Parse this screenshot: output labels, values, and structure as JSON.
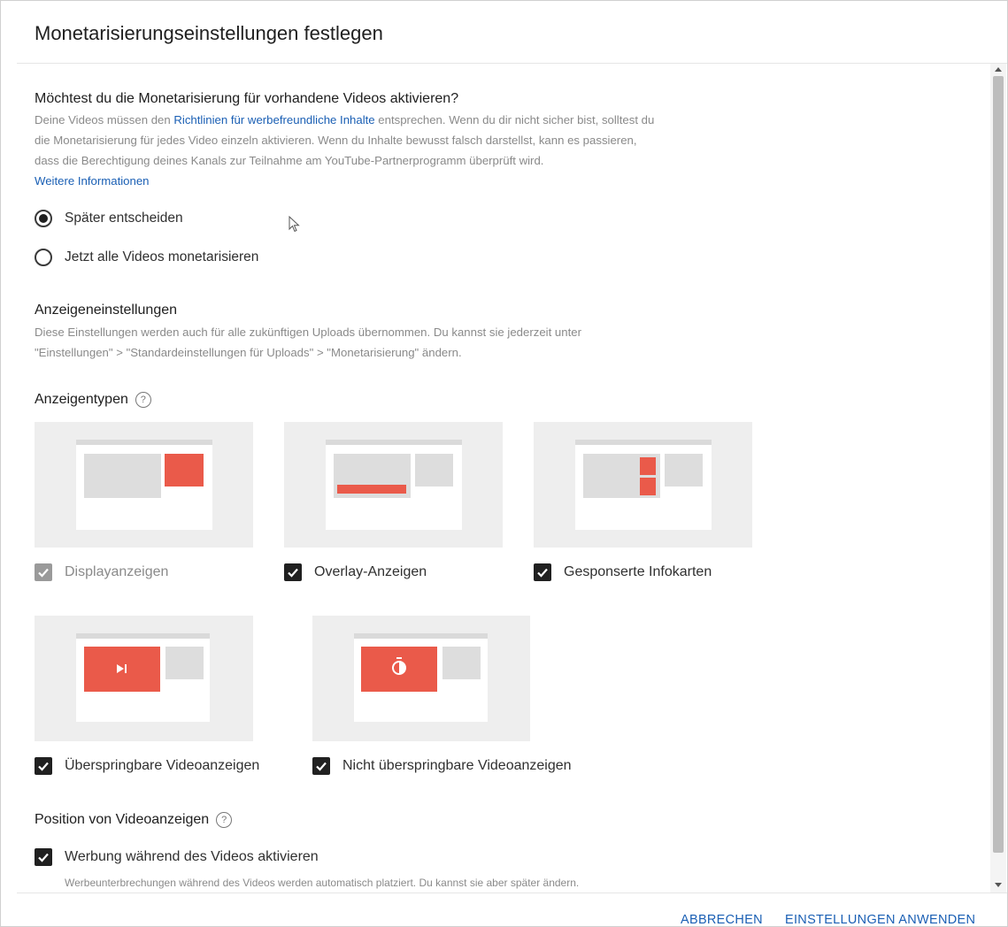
{
  "dialog": {
    "title": "Monetarisierungseinstellungen festlegen"
  },
  "monetize": {
    "heading": "Möchtest du die Monetarisierung für vorhandene Videos aktivieren?",
    "desc_line1_pre": "Deine Videos müssen den ",
    "desc_link": "Richtlinien für werbefreundliche Inhalte",
    "desc_line1_post": " entsprechen. Wenn du dir nicht sicher bist, solltest du",
    "desc_line2": "die Monetarisierung für jedes Video einzeln aktivieren. Wenn du Inhalte bewusst falsch darstellst, kann es passieren,",
    "desc_line3": "dass die Berechtigung deines Kanals zur Teilnahme am YouTube-Partnerprogramm überprüft wird.",
    "more_link": "Weitere Informationen",
    "options": [
      {
        "label": "Später entscheiden",
        "selected": true
      },
      {
        "label": "Jetzt alle Videos monetarisieren",
        "selected": false
      }
    ]
  },
  "ad_settings": {
    "heading": "Anzeigeneinstellungen",
    "desc_line1": "Diese Einstellungen werden auch für alle zukünftigen Uploads übernommen. Du kannst sie jederzeit unter",
    "desc_line2": "\"Einstellungen\" > \"Standardeinstellungen für Uploads\" > \"Monetarisierung\" ändern."
  },
  "ad_types": {
    "heading": "Anzeigentypen",
    "items": [
      {
        "label": "Displayanzeigen",
        "checked": true,
        "disabled": true
      },
      {
        "label": "Overlay-Anzeigen",
        "checked": true,
        "disabled": false
      },
      {
        "label": "Gesponserte Infokarten",
        "checked": true,
        "disabled": false
      },
      {
        "label": "Überspringbare Videoanzeigen",
        "checked": true,
        "disabled": false
      },
      {
        "label": "Nicht überspringbare Videoanzeigen",
        "checked": true,
        "disabled": false
      }
    ]
  },
  "position": {
    "heading": "Position von Videoanzeigen",
    "option_label": "Werbung während des Videos aktivieren",
    "option_checked": true,
    "option_desc": "Werbeunterbrechungen während des Videos werden automatisch platziert. Du kannst sie aber später ändern."
  },
  "footer": {
    "cancel": "ABBRECHEN",
    "apply": "EINSTELLUNGEN ANWENDEN"
  },
  "colors": {
    "accent": "#1a5fb4",
    "ad_red": "#ea5a4a",
    "placeholder_gray": "#dddddd",
    "card_bg": "#eeeeee"
  },
  "icons": {
    "help": "help-circle-icon",
    "skip": "skip-forward-icon",
    "timer": "stopwatch-icon",
    "check": "check-icon"
  }
}
